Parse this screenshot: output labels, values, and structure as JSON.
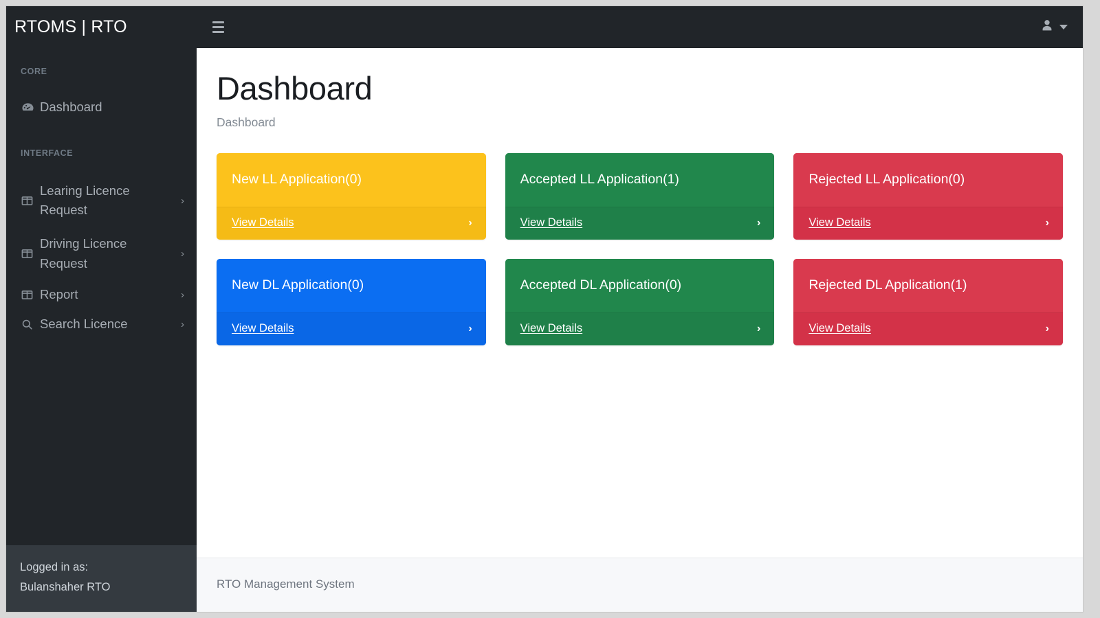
{
  "brand": {
    "title": "RTOMS | RTO"
  },
  "topbar": {
    "menu_toggle": "hamburger-menu",
    "user_icon": "user-icon",
    "caret_icon": "chevron-down-icon"
  },
  "sidebar": {
    "sections": [
      {
        "heading": "CORE"
      },
      {
        "heading": "INTERFACE"
      }
    ],
    "core_items": [
      {
        "label": "Dashboard",
        "icon": "tachometer-icon",
        "has_chevron": false
      }
    ],
    "interface_items": [
      {
        "label": "Learing Licence Request",
        "icon": "columns-icon",
        "has_chevron": true,
        "chevron": "›"
      },
      {
        "label": "Driving Licence Request",
        "icon": "columns-icon",
        "has_chevron": true,
        "chevron": "›"
      },
      {
        "label": "Report",
        "icon": "columns-icon",
        "has_chevron": true,
        "chevron": "›"
      },
      {
        "label": "Search Licence",
        "icon": "search-icon",
        "has_chevron": true,
        "chevron": "›"
      }
    ],
    "footer": {
      "line1": "Logged in as:",
      "line2": "Bulanshaher RTO"
    }
  },
  "page": {
    "title": "Dashboard",
    "breadcrumb": "Dashboard"
  },
  "cards": [
    {
      "title": "New LL Application(0)",
      "link": "View Details",
      "arrow": "›",
      "color": "#fcc21c",
      "theme": "yellow"
    },
    {
      "title": "Accepted LL Application(1)",
      "link": "View Details",
      "arrow": "›",
      "color": "#21874c",
      "theme": "green"
    },
    {
      "title": "Rejected LL Application(0)",
      "link": "View Details",
      "arrow": "›",
      "color": "#d93a4e",
      "theme": "red"
    },
    {
      "title": "New DL Application(0)",
      "link": "View Details",
      "arrow": "›",
      "color": "#0b6ef2",
      "theme": "blue"
    },
    {
      "title": "Accepted DL Application(0)",
      "link": "View Details",
      "arrow": "›",
      "color": "#21874c",
      "theme": "green"
    },
    {
      "title": "Rejected DL Application(1)",
      "link": "View Details",
      "arrow": "›",
      "color": "#d93a4e",
      "theme": "red"
    }
  ],
  "footer": {
    "text": "RTO Management System"
  }
}
